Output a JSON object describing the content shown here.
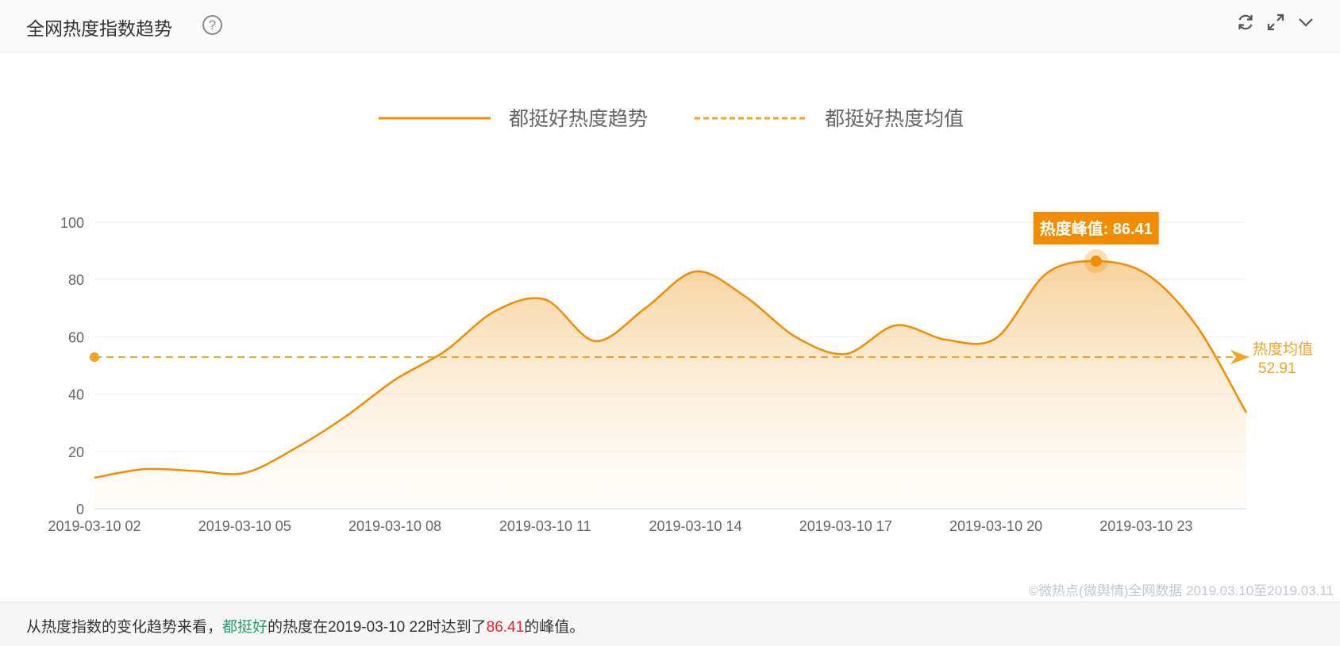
{
  "header": {
    "title": "全网热度指数趋势",
    "help_icon": "question-circle-icon",
    "tools": [
      "refresh-icon",
      "expand-icon",
      "chevron-down-icon"
    ]
  },
  "colors": {
    "accent": "#f28c00",
    "mean_line": "#f5a323",
    "tooltip_bg": "#f28c00",
    "keyword": "#2a9d6b",
    "peak_number": "#e8232a"
  },
  "chart_data": {
    "type": "area",
    "legend": {
      "placement": "top-center",
      "items": [
        {
          "name": "都挺好热度趋势",
          "style": "solid"
        },
        {
          "name": "都挺好热度均值",
          "style": "dashed"
        }
      ]
    },
    "x": [
      "2019-03-10 02",
      "2019-03-10 03",
      "2019-03-10 04",
      "2019-03-10 05",
      "2019-03-10 06",
      "2019-03-10 07",
      "2019-03-10 08",
      "2019-03-10 09",
      "2019-03-10 10",
      "2019-03-10 11",
      "2019-03-10 12",
      "2019-03-10 13",
      "2019-03-10 14",
      "2019-03-10 15",
      "2019-03-10 16",
      "2019-03-10 17",
      "2019-03-10 18",
      "2019-03-10 19",
      "2019-03-10 20",
      "2019-03-10 21",
      "2019-03-10 22",
      "2019-03-10 23",
      "2019-03-11 00",
      "2019-03-11 01"
    ],
    "x_tick_labels": [
      "2019-03-10 02",
      "2019-03-10 05",
      "2019-03-10 08",
      "2019-03-10 11",
      "2019-03-10 14",
      "2019-03-10 17",
      "2019-03-10 20",
      "2019-03-10 23"
    ],
    "series": [
      {
        "name": "都挺好热度趋势",
        "values": [
          10.8,
          13.8,
          13.2,
          12.5,
          21,
          32,
          45,
          55,
          69,
          73,
          58.5,
          70,
          82.8,
          74,
          60,
          54,
          64,
          59,
          59.5,
          82,
          86.41,
          82,
          64,
          33.5
        ]
      }
    ],
    "mean": {
      "name": "都挺好热度均值",
      "value": 52.91,
      "label": "热度均值",
      "value_text": "52.91"
    },
    "peak": {
      "x": "2019-03-10 22",
      "value": 86.41,
      "label": "热度峰值: 86.41"
    },
    "ylim": [
      0,
      100
    ],
    "yticks": [
      0,
      20,
      40,
      60,
      80,
      100
    ],
    "grid": true
  },
  "copyright": "©微热点(微舆情)全网数据 2019.03.10至2019.03.11",
  "summary": {
    "prefix": "从热度指数的变化趋势来看，",
    "keyword": "都挺好",
    "middle": "的热度在2019-03-10 22时达到了",
    "peak_value": "86.41",
    "suffix": "的峰值。"
  }
}
